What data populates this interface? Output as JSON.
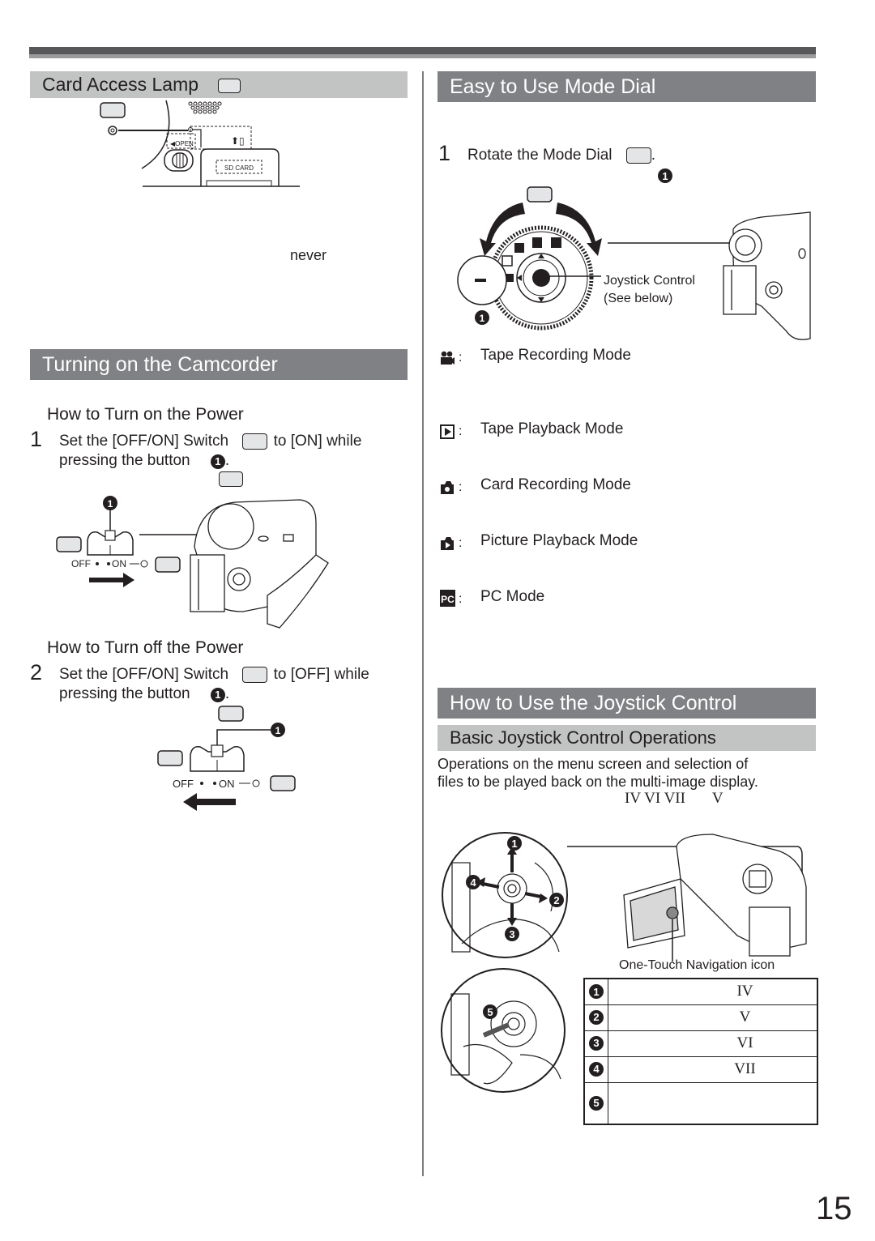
{
  "page_number": "15",
  "left_column": {
    "card_access_lamp": {
      "title": "Card Access Lamp",
      "diagram_labels": {
        "open": "◀OPEN",
        "sd_card": "SD CARD"
      },
      "body_fragment": "never"
    },
    "turning_on": {
      "title": "Turning on the Camcorder",
      "power_on": {
        "subheading": "How to Turn on the Power",
        "step_number": "1",
        "line1_a": "Set the [OFF/ON] Switch",
        "line1_b": "to [ON] while",
        "line2": "pressing the button",
        "marker": "1",
        "switch_labels": {
          "off": "OFF",
          "on": "ON"
        }
      },
      "power_off": {
        "subheading": "How to Turn off the Power",
        "step_number": "2",
        "line1_a": "Set the [OFF/ON] Switch",
        "line1_b": "to [OFF] while",
        "line2": "pressing the button",
        "marker": "1",
        "switch_labels": {
          "off": "OFF",
          "on": "ON"
        }
      }
    }
  },
  "right_column": {
    "mode_dial": {
      "title": "Easy to Use  Mode Dial",
      "step_number": "1",
      "step_text": "Rotate the Mode Dial",
      "marker": "1",
      "joystick_label_1": "Joystick Control",
      "joystick_label_2": "(See below)",
      "modes": [
        {
          "icon": "tape-recording-icon",
          "label": "Tape Recording Mode"
        },
        {
          "icon": "tape-playback-icon",
          "label": "Tape Playback Mode"
        },
        {
          "icon": "card-recording-icon",
          "label": "Card Recording Mode"
        },
        {
          "icon": "picture-playback-icon",
          "label": "Picture Playback Mode"
        },
        {
          "icon": "pc-mode-icon",
          "label": "PC Mode"
        }
      ]
    },
    "joystick": {
      "title": "How to Use the  Joystick Control",
      "subtitle": "Basic Joystick Control Operations",
      "desc_line1": "Operations on the menu screen and selection of",
      "desc_line2": "files to be played back on the multi-image display.",
      "roman_refs": "IV VI VII       V",
      "nav_icon_label": "One-Touch Navigation icon",
      "diagram_markers": [
        "1",
        "2",
        "3",
        "4",
        "5"
      ],
      "operations": [
        {
          "n": "1",
          "ref": "IV"
        },
        {
          "n": "2",
          "ref": "V"
        },
        {
          "n": "3",
          "ref": "VI"
        },
        {
          "n": "4",
          "ref": "VII"
        },
        {
          "n": "5",
          "ref": ""
        }
      ]
    }
  }
}
